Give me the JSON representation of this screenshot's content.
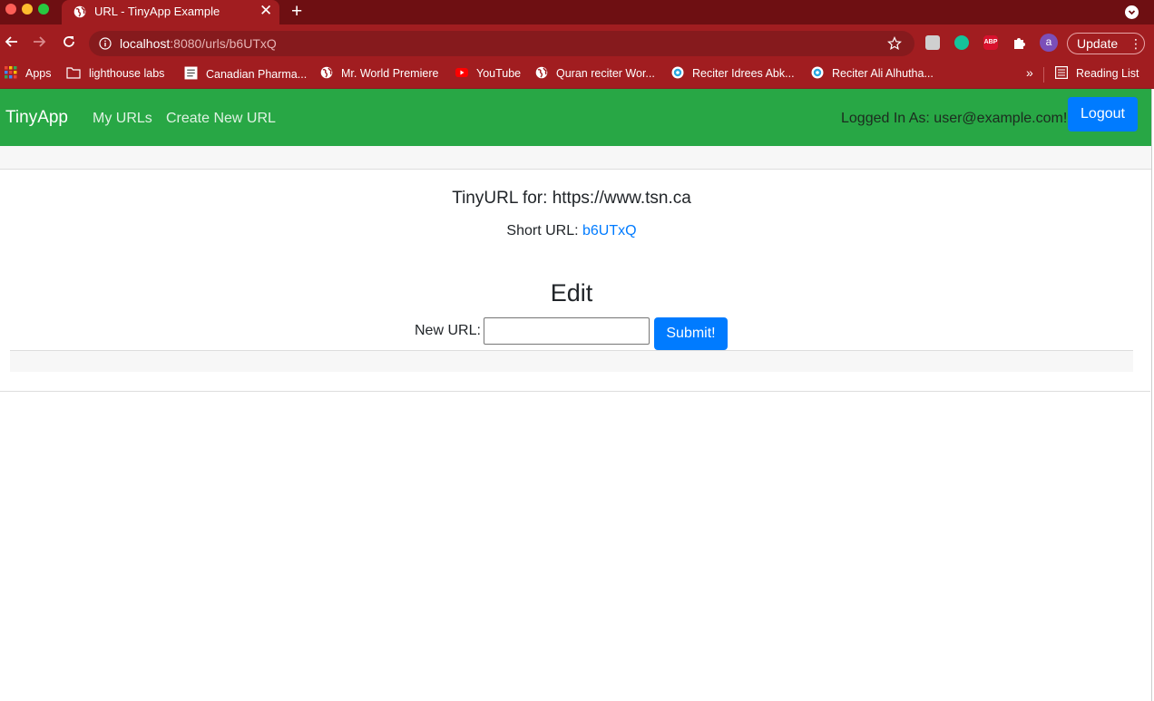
{
  "browser": {
    "tab": {
      "title": "URL - TinyApp Example",
      "close": "✕"
    },
    "new_tab": "+",
    "address": {
      "host": "localhost",
      "rest": ":8080/urls/b6UTxQ"
    },
    "profile_initial": "a",
    "update_label": "Update",
    "update_menu": "⋮",
    "extensions": {
      "abp": "ABP"
    },
    "bookmarks": [
      {
        "label": "Apps",
        "icon": "apps-grid-icon"
      },
      {
        "label": "lighthouse labs",
        "icon": "folder-icon"
      },
      {
        "label": "Canadian Pharma...",
        "icon": "page-icon"
      },
      {
        "label": "Mr. World Premiere",
        "icon": "globe-icon"
      },
      {
        "label": "YouTube",
        "icon": "youtube-icon"
      },
      {
        "label": "Quran reciter Wor...",
        "icon": "globe-icon"
      },
      {
        "label": "Reciter Idrees Abk...",
        "icon": "site-icon"
      },
      {
        "label": "Reciter Ali Alhutha...",
        "icon": "site-icon"
      }
    ],
    "bookmarks_overflow": "»",
    "reading_list": "Reading List"
  },
  "nav": {
    "brand": "TinyApp",
    "my_urls": "My URLs",
    "create_new": "Create New URL",
    "logged_in": "Logged In As: user@example.com!",
    "logout": "Logout"
  },
  "main": {
    "heading": "TinyURL for: https://www.tsn.ca",
    "short_label": "Short URL:",
    "short_link": "b6UTxQ",
    "edit_title": "Edit",
    "new_url_label": "New URL:",
    "new_url_value": "",
    "submit": "Submit!"
  },
  "colors": {
    "chrome_dark": "#6e0f12",
    "chrome": "#a11d20",
    "navbar": "#28a745",
    "primary": "#007bff"
  }
}
